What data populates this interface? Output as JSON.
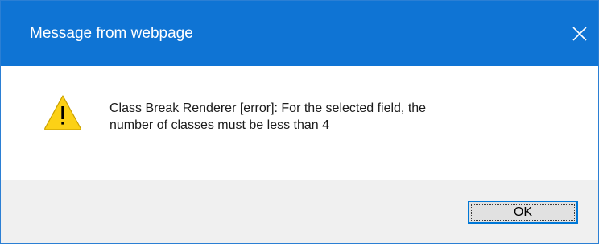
{
  "window": {
    "title": "Message from webpage",
    "close_icon": "close-icon",
    "titlebar_color": "#0f74d4"
  },
  "message": {
    "icon": "warning-icon",
    "line1": "Class Break Renderer [error]: For the selected field, the",
    "line2": "number of classes must be less than 4"
  },
  "buttons": {
    "ok_label": "OK"
  }
}
